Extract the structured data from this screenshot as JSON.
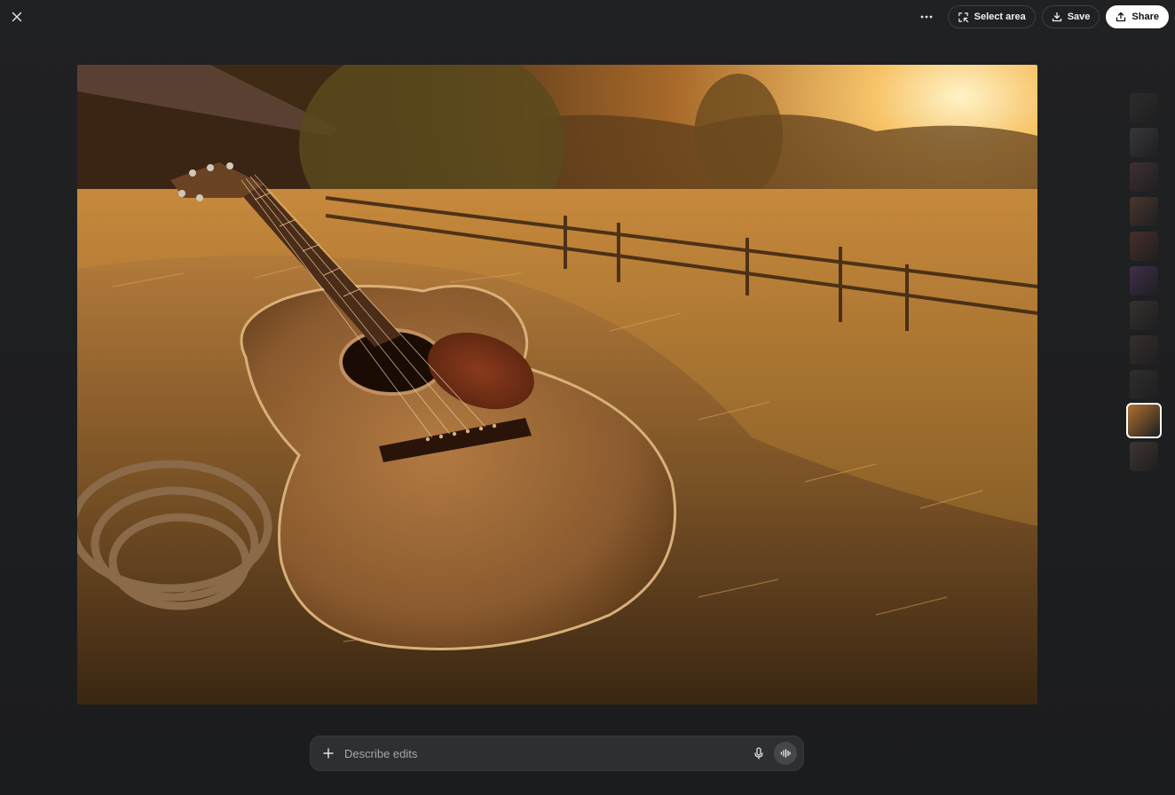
{
  "header": {
    "close_icon": "close-icon",
    "more_icon": "more-horizontal-icon",
    "select_area_label": "Select area",
    "save_label": "Save",
    "share_label": "Share"
  },
  "image": {
    "subject_icon": "acoustic-guitar-photo"
  },
  "thumbnails": {
    "count": 11,
    "active_index": 9,
    "colors": [
      "#3a3530",
      "#4a4a4c",
      "#5a3c40",
      "#6a4a34",
      "#6a3a30",
      "#5a3a6a",
      "#4a4038",
      "#4a3c32",
      "#3e3a34",
      "#b07030",
      "#5a4a3e"
    ]
  },
  "composer": {
    "placeholder": "Describe edits",
    "plus_icon": "plus-icon",
    "mic_icon": "microphone-icon",
    "voice_icon": "voice-waveform-icon"
  },
  "colors": {
    "background": "#1d1e20",
    "pill_border": "#3d3e41",
    "composer_bg": "#2e2f32"
  }
}
